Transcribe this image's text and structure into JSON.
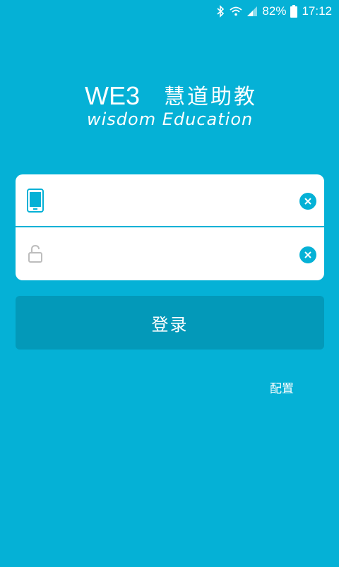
{
  "status_bar": {
    "battery": "82%",
    "time": "17:12",
    "icons": [
      "bluetooth-icon",
      "wifi-icon",
      "signal-icon",
      "battery-icon"
    ]
  },
  "logo": {
    "brand": "WE3",
    "chinese_name": "慧道助教",
    "subtitle": "wisdom Education"
  },
  "form": {
    "phone_placeholder": "",
    "password_placeholder": "",
    "icons": [
      "phone-icon",
      "lock-icon",
      "clear-icon"
    ]
  },
  "login_button": {
    "label": "登录"
  },
  "config_link": {
    "label": "配置"
  },
  "colors": {
    "background": "#05b1d6",
    "button": "#0399b9",
    "card": "#ffffff"
  }
}
